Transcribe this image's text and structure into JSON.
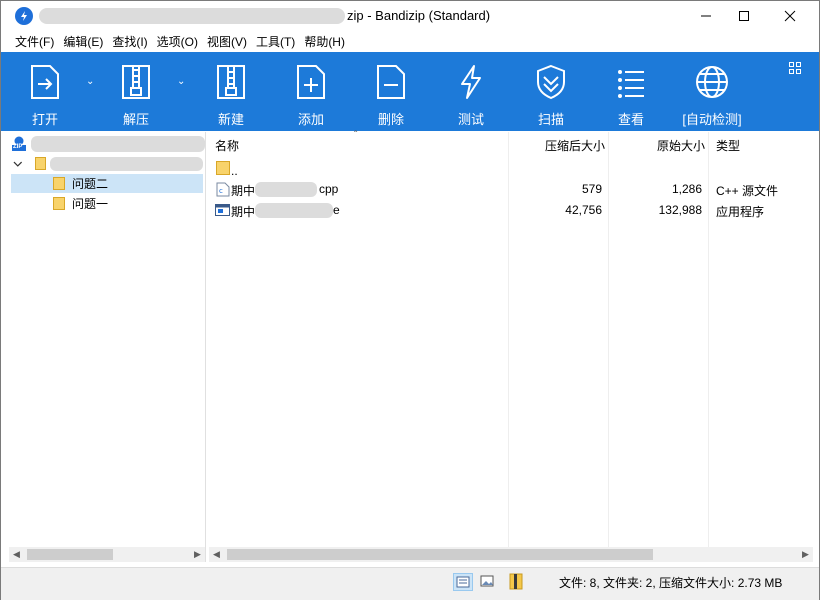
{
  "window": {
    "title_suffix": "zip - Bandizip (Standard)",
    "minimize_glyph": "—",
    "maximize_glyph": "☐",
    "close_glyph": "✕"
  },
  "menu": [
    "文件(F)",
    "编辑(E)",
    "查找(I)",
    "选项(O)",
    "视图(V)",
    "工具(T)",
    "帮助(H)"
  ],
  "toolbar": {
    "open": "打开",
    "extract": "解压",
    "new": "新建",
    "add": "添加",
    "delete": "删除",
    "test": "测试",
    "scan": "扫描",
    "view": "查看",
    "autodetect": "[自动检测]",
    "accent_color": "#1d7ad9"
  },
  "tree": {
    "zip_badge": "ZIP",
    "items": [
      {
        "label": "问题二",
        "selected": true
      },
      {
        "label": "问题一",
        "selected": false
      }
    ]
  },
  "list": {
    "headers": {
      "name": "名称",
      "compressed": "压缩后大小",
      "original": "原始大小",
      "type": "类型"
    },
    "rows": [
      {
        "name_prefix": "..",
        "name_suffix": "",
        "compressed": "",
        "original": "",
        "type": "",
        "icon": "folder-icon"
      },
      {
        "name_prefix": "期中",
        "name_suffix": "cpp",
        "compressed": "579",
        "original": "1,286",
        "type": "C++ 源文件",
        "icon": "cpp-file-icon"
      },
      {
        "name_prefix": "期中",
        "name_suffix": "e",
        "compressed": "42,756",
        "original": "132,988",
        "type": "应用程序",
        "icon": "exe-file-icon"
      }
    ]
  },
  "status": {
    "text": "文件: 8, 文件夹: 2, 压缩文件大小: 2.73 MB"
  }
}
